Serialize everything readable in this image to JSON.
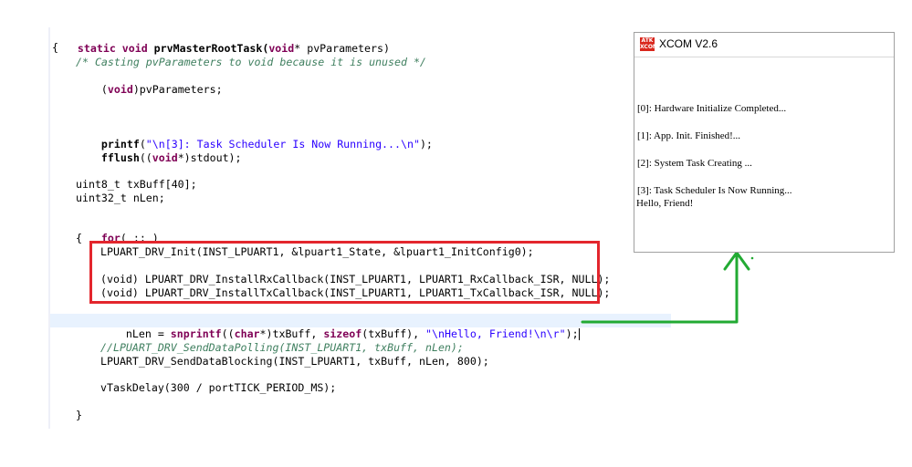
{
  "editor": {
    "lines": {
      "l1_kw1": "static void",
      "l1_fn": " prvMasterRootTask(",
      "l1_kw2": "void",
      "l1_rest": "* pvParameters)",
      "l2": "{",
      "l3": "/* Casting pvParameters to void because it is unused */",
      "l4_open": "(",
      "l4_kw": "void",
      "l4_rest": ")pvParameters;",
      "l5_fn": "printf",
      "l5_open": "(",
      "l5_str": "\"\\n[3]: Task Scheduler Is Now Running...\\n\"",
      "l5_close": ");",
      "l6_fn": "fflush",
      "l6_open": "((",
      "l6_kw": "void",
      "l6_rest": "*)stdout);",
      "l7": "uint8_t txBuff[40];",
      "l8": "uint32_t nLen;",
      "l9_kw": "for",
      "l9_rest": "( ;; )",
      "l10": "{",
      "l11": "LPUART_DRV_Init(INST_LPUART1, &lpuart1_State, &lpuart1_InitConfig0);",
      "l12": "(void) LPUART_DRV_InstallRxCallback(INST_LPUART1, LPUART1_RxCallback_ISR, NULL);",
      "l13": "(void) LPUART_DRV_InstallTxCallback(INST_LPUART1, LPUART1_TxCallback_ISR, NULL);",
      "l14_a": "nLen = ",
      "l14_kw1": "snprintf",
      "l14_b": "((",
      "l14_kw2": "char",
      "l14_c": "*)txBuff, ",
      "l14_kw3": "sizeof",
      "l14_d": "(txBuff), ",
      "l14_str": "\"\\nHello, Friend!\\n\\r\"",
      "l14_e": ");",
      "l15": "//LPUART_DRV_SendDataPolling(INST_LPUART1, txBuff, nLen);",
      "l16": "LPUART_DRV_SendDataBlocking(INST_LPUART1, txBuff, nLen, 800);",
      "l17": "vTaskDelay(300 / portTICK_PERIOD_MS);",
      "l18": "}"
    }
  },
  "xcom": {
    "logo_text": "ATK XCOM",
    "title": "XCOM V2.6",
    "output": [
      "[0]: Hardware Initialize Completed...",
      "[1]: App. Init. Finished!...",
      "[2]: System Task Creating ...",
      "[3]: Task Scheduler Is Now Running...",
      "Hello, Friend!"
    ]
  },
  "colors": {
    "highlight_box": "#e3262d",
    "arrow": "#22aa33",
    "keyword": "#7f0055",
    "comment": "#3f7f5f",
    "string": "#2a00ff"
  }
}
